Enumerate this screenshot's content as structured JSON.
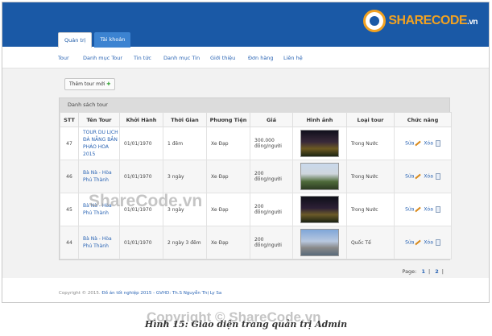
{
  "header": {
    "tabs": [
      {
        "label": "Quản trị",
        "active": true
      },
      {
        "label": "Tài khoản",
        "active": false
      }
    ],
    "logo": {
      "text_main": "SHARECODE",
      "text_suffix": ".vn"
    },
    "color": "#1a59a6"
  },
  "nav": [
    "Tour",
    "Danh mục Tour",
    "Tin tức",
    "Danh mục Tin",
    "Giới thiệu",
    "Đơn hàng",
    "Liên hệ"
  ],
  "add_button": {
    "label": "Thêm tour mới",
    "icon": "plus-icon"
  },
  "panel": {
    "title": "Danh sách tour",
    "columns": [
      "STT",
      "Tên Tour",
      "Khởi Hành",
      "Thời Gian",
      "Phương Tiện",
      "Giá",
      "Hình ảnh",
      "Loại tour",
      "Chức năng"
    ],
    "rows": [
      {
        "stt": "47",
        "name": "TOUR DU LỊCH ĐÀ NẴNG BẮN PHÁO HOA 2015",
        "start": "01/01/1970",
        "duration": "1 đêm",
        "vehicle": "Xe Đạp",
        "price": "300.000 đồng/người",
        "type": "Trong Nước",
        "image": "fireworks-image"
      },
      {
        "stt": "46",
        "name": "Bà Nà - Hòa Phú Thành",
        "start": "01/01/1970",
        "duration": "3 ngày",
        "vehicle": "Xe Đạp",
        "price": "200 đồng/người",
        "type": "Trong Nước",
        "image": "mountain-image"
      },
      {
        "stt": "45",
        "name": "Bà Nà - Hòa Phú Thành",
        "start": "01/01/1970",
        "duration": "3 ngày",
        "vehicle": "Xe Đạp",
        "price": "200 đồng/người",
        "type": "Trong Nước",
        "image": "fireworks-image"
      },
      {
        "stt": "44",
        "name": "Bà Nà - Hòa Phú Thành",
        "start": "01/01/1970",
        "duration": "2 ngày 3 đêm",
        "vehicle": "Xe Đạp",
        "price": "200 đồng/người",
        "type": "Quốc Tế",
        "image": "city-image"
      }
    ],
    "actions": {
      "edit": "Sửa",
      "delete": "Xóa"
    }
  },
  "pager": {
    "label": "Page:",
    "pages": [
      "1",
      "2"
    ],
    "separator": "|"
  },
  "footer": {
    "copyright": "Copyright © 2015.",
    "link": "Đồ án tốt nghiệp 2015 - GVHD: Th.S Nguyễn Thị Ly Sa"
  },
  "caption": "Hình 15: Giao diện trang quản trị Admin",
  "watermark": "ShareCode.vn",
  "watermark_copy": "Copyright © ShareCode.vn"
}
